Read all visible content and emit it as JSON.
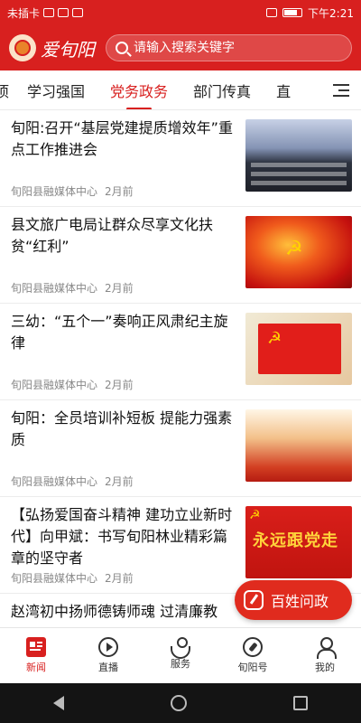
{
  "status_bar": {
    "carrier": "未插卡",
    "time": "下午2:21"
  },
  "header": {
    "app_name": "爱旬阳",
    "search_placeholder": "请输入搜索关键字"
  },
  "tabs": [
    {
      "label": "项",
      "active": false
    },
    {
      "label": "学习强国",
      "active": false
    },
    {
      "label": "党务政务",
      "active": true
    },
    {
      "label": "部门传真",
      "active": false
    },
    {
      "label": "直",
      "active": false
    }
  ],
  "news": [
    {
      "title": "旬阳:召开“基层党建提质增效年”重点工作推进会",
      "source": "旬阳县融媒体中心",
      "time": "2月前",
      "thumb": "meeting-hall"
    },
    {
      "title": "县文旅广电局让群众尽享文化扶贫“红利”",
      "source": "旬阳县融媒体中心",
      "time": "2月前",
      "thumb": "red-glow-emblem"
    },
    {
      "title": "三幼：“五个一”奏响正风肃纪主旋律",
      "source": "旬阳县融媒体中心",
      "time": "2月前",
      "thumb": "party-flag"
    },
    {
      "title": "旬阳：全员培训补短板 提能力强素质",
      "source": "旬阳县融媒体中心",
      "time": "2月前",
      "thumb": "red-dawn"
    },
    {
      "title": "【弘扬爱国奋斗精神 建功立业新时代】向甲斌：书写旬阳林业精彩篇章的坚守者",
      "source": "旬阳县融媒体中心",
      "time": "2月前",
      "thumb": "red-banner",
      "thumb_text": "永远跟党走"
    },
    {
      "title": "赵湾初中扬师德铸师魂 过清廉教",
      "source": "",
      "time": "",
      "thumb": ""
    }
  ],
  "float_button": {
    "label": "百姓问政",
    "icon": "pen-icon"
  },
  "bottom_nav": [
    {
      "label": "新闻",
      "icon": "news-icon",
      "active": true
    },
    {
      "label": "直播",
      "icon": "play-icon",
      "active": false
    },
    {
      "label": "服务",
      "icon": "service-icon",
      "active": false
    },
    {
      "label": "旬阳号",
      "icon": "compass-icon",
      "active": false
    },
    {
      "label": "我的",
      "icon": "user-icon",
      "active": false
    }
  ],
  "colors": {
    "brand_red": "#d8201f",
    "meta_gray": "#888888"
  }
}
